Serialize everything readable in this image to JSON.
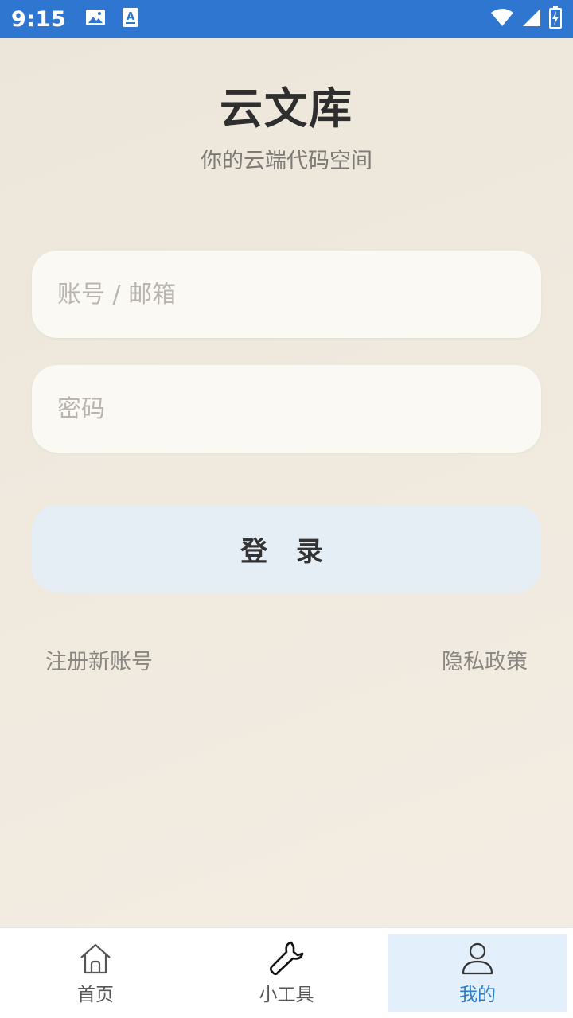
{
  "status_bar": {
    "time": "9:15",
    "icons_left": [
      "image-icon",
      "text-a-icon"
    ],
    "icons_right": [
      "wifi-icon",
      "signal-icon",
      "battery-charging-icon"
    ],
    "background": "#2f76d0"
  },
  "header": {
    "title": "云文库",
    "subtitle": "你的云端代码空间"
  },
  "form": {
    "account_placeholder": "账号 / 邮箱",
    "account_value": "",
    "password_placeholder": "密码",
    "password_value": "",
    "login_label": "登 录"
  },
  "links": {
    "register": "注册新账号",
    "privacy": "隐私政策"
  },
  "bottom_nav": {
    "items": [
      {
        "label": "首页",
        "icon": "home-icon",
        "active": false
      },
      {
        "label": "小工具",
        "icon": "wrench-icon",
        "active": false
      },
      {
        "label": "我的",
        "icon": "user-icon",
        "active": true
      }
    ],
    "active_color": "#2c7fc9"
  }
}
